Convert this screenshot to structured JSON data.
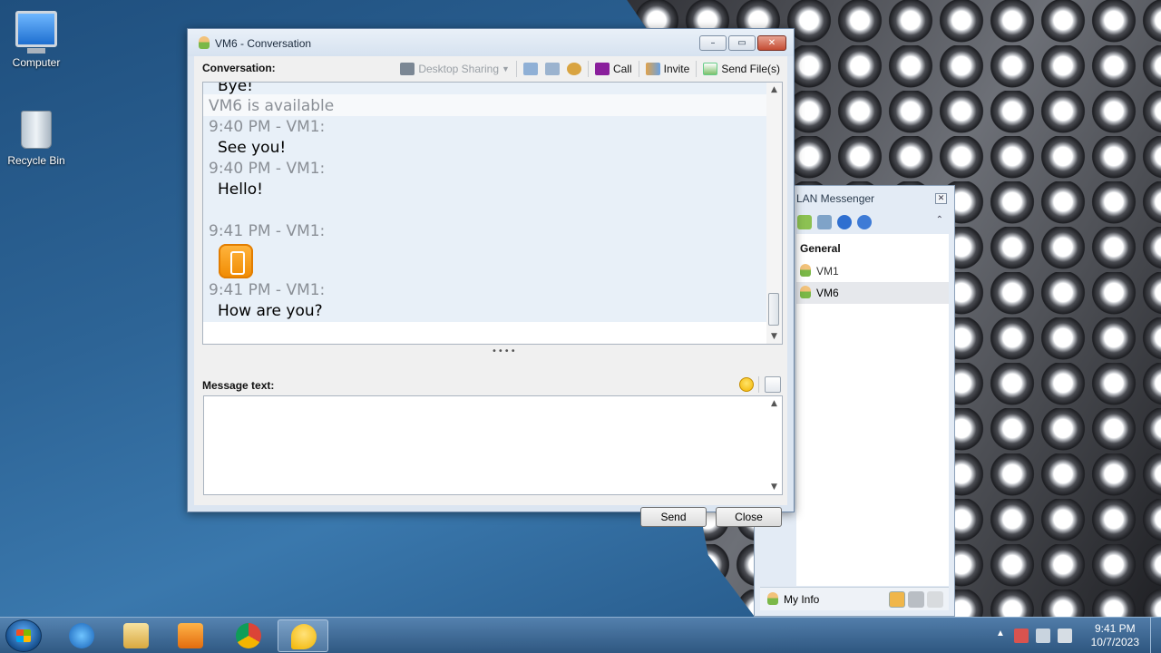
{
  "desktop": {
    "icons": [
      {
        "label": "Computer"
      },
      {
        "label": "Recycle Bin"
      }
    ]
  },
  "conversation_window": {
    "title": "VM6 - Conversation",
    "controls": {
      "minimize": "–",
      "restore": "▭",
      "close": "✕"
    },
    "conversation_label": "Conversation:",
    "toolbar": {
      "desktop_sharing": "Desktop Sharing",
      "call": "Call",
      "invite": "Invite",
      "send_files": "Send File(s)"
    },
    "messages": {
      "bye": "Bye!",
      "available": "VM6 is available",
      "m1_meta": "9:40 PM - VM1:",
      "m1_text": "See you!",
      "m2_meta": "9:40 PM - VM1:",
      "m2_text": "Hello!",
      "m3_meta": "9:41 PM - VM1:",
      "m4_meta": "9:41 PM - VM1:",
      "m4_text": "How are you?"
    },
    "message_text_label": "Message text:",
    "message_value": "",
    "send_button": "Send",
    "close_button": "Close"
  },
  "lan_messenger": {
    "title": "LAN Messenger",
    "group": "General",
    "users": [
      {
        "name": "VM1"
      },
      {
        "name": "VM6"
      }
    ],
    "my_info": "My Info"
  },
  "taskbar": {
    "time": "9:41 PM",
    "date": "10/7/2023"
  },
  "colors": {
    "accent": "#2d6496",
    "chat_background": "#e8f0f8",
    "meta_text": "#8a8f96"
  }
}
